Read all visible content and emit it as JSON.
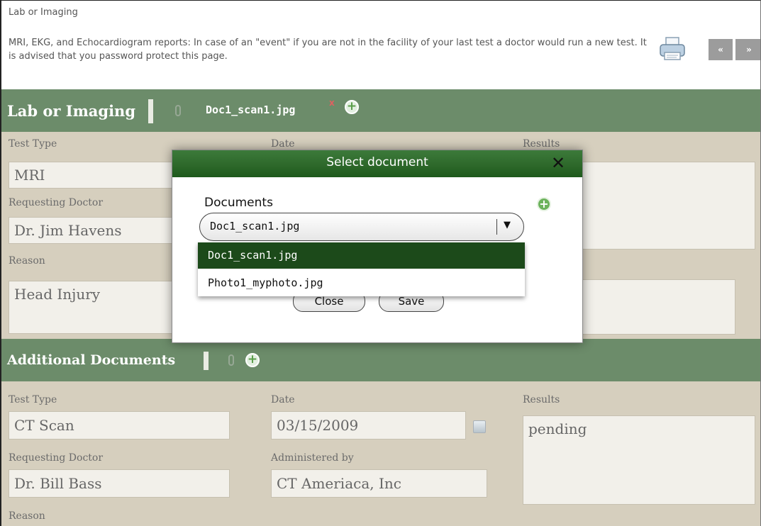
{
  "page": {
    "title": "Lab or Imaging",
    "description": "MRI, EKG, and Echocardiogram reports: In case of an \"event\" if you are not in the facility of your last test a doctor would run a new test. It is advised that you password protect this page.",
    "nav_prev": "«",
    "nav_next": "»"
  },
  "lab_section": {
    "title": "Lab or Imaging",
    "attachment": "Doc1_scan1.jpg",
    "remove_mark": "x",
    "add_symbol": "+",
    "labels": {
      "test_type": "Test Type",
      "date": "Date",
      "results": "Results",
      "requesting_doctor": "Requesting Doctor",
      "reason": "Reason"
    },
    "values": {
      "test_type": "MRI",
      "requesting_doctor": "Dr. Jim Havens",
      "reason": "Head Injury"
    }
  },
  "additional_section": {
    "title": "Additional Documents",
    "add_symbol": "+",
    "labels": {
      "test_type": "Test Type",
      "date": "Date",
      "results": "Results",
      "requesting_doctor": "Requesting Doctor",
      "administered_by": "Administered by",
      "reason": "Reason"
    },
    "values": {
      "test_type": "CT Scan",
      "date": "03/15/2009",
      "results": "pending",
      "requesting_doctor": "Dr. Bill Bass",
      "administered_by": "CT Ameriaca, Inc"
    }
  },
  "modal": {
    "title": "Select document",
    "close_symbol": "✕",
    "documents_label": "Documents",
    "add_symbol": "+",
    "selected": "Doc1_scan1.jpg",
    "arrow": "▼",
    "options": [
      "Doc1_scan1.jpg",
      "Photo1_myphoto.jpg"
    ],
    "close_button": "Close",
    "save_button": "Save"
  },
  "colors": {
    "section_bar": "#6c8c6a",
    "panel": "#d6cfbe",
    "modal_header": "#2f6a2c",
    "dropdown_selected": "#1c4a1a"
  },
  "icons": [
    "printer-icon",
    "paperclip-icon",
    "add-icon",
    "calendar-icon",
    "close-icon",
    "dropdown-arrow-icon"
  ]
}
